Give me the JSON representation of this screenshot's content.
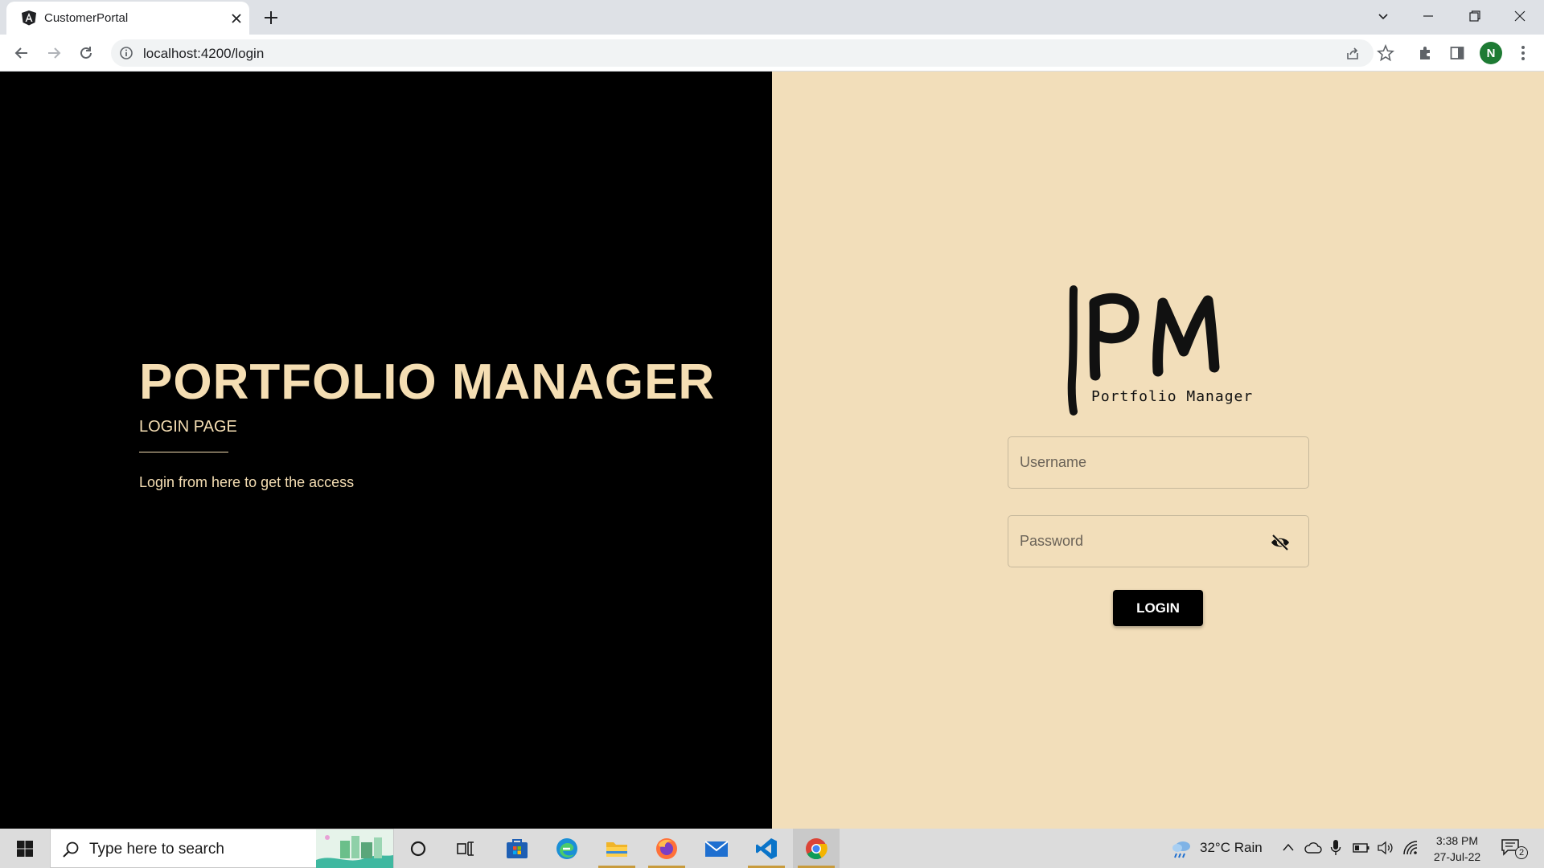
{
  "browser": {
    "tab_title": "CustomerPortal",
    "url": "localhost:4200/login",
    "profile_initial": "N"
  },
  "left": {
    "title": "PORTFOLIO MANAGER",
    "subtitle": "LOGIN PAGE",
    "description": "Login from here to get the access"
  },
  "logo": {
    "mark": "|PM",
    "tagline": "Portfolio Manager"
  },
  "form": {
    "username_placeholder": "Username",
    "password_placeholder": "Password",
    "login_label": "LOGIN"
  },
  "taskbar": {
    "search_placeholder": "Type here to search",
    "weather": "32°C  Rain",
    "time": "3:38 PM",
    "date": "27-Jul-22",
    "notifications": "2"
  },
  "colors": {
    "left_bg": "#000000",
    "right_bg": "#f2deba",
    "accent_text": "#f5deb3"
  },
  "icons": [
    "angular-icon",
    "close-icon",
    "plus-icon",
    "back-icon",
    "forward-icon",
    "reload-icon",
    "info-icon",
    "share-icon",
    "star-icon",
    "extensions-icon",
    "sidepanel-icon",
    "menu-icon",
    "eye-off-icon",
    "windows-icon",
    "search-icon",
    "cortana-icon",
    "taskview-icon",
    "store-icon",
    "edge-icon",
    "folder-icon",
    "firefox-icon",
    "mail-icon",
    "vscode-icon",
    "chrome-icon",
    "weather-icon",
    "chevron-up-icon",
    "cloud-icon",
    "mic-icon",
    "battery-icon",
    "volume-icon",
    "wifi-icon",
    "notification-icon"
  ]
}
